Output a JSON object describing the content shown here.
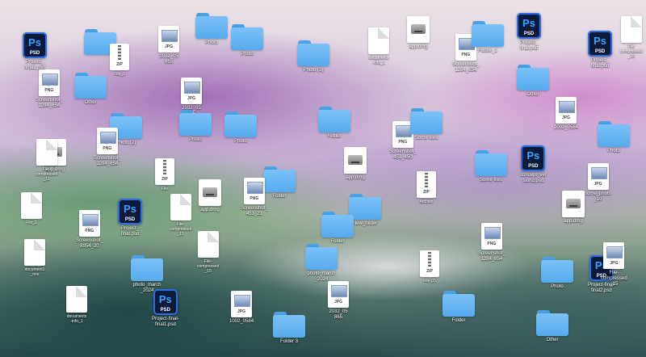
{
  "desktop": {
    "icons": [
      {
        "type": "psd",
        "name": "Project_\nfinal1.psd",
        "badge": "PSD",
        "glyph": "Ps",
        "icon": "photoshop-icon"
      },
      {
        "type": "folder",
        "name": "",
        "icon": "folder-icon"
      },
      {
        "type": "zip",
        "name": "File_1",
        "badge": "ZIP",
        "icon": "zip-file-icon"
      },
      {
        "type": "img",
        "name": "2032_05\n865",
        "badge": "JPG",
        "icon": "image-file-icon"
      },
      {
        "type": "folder",
        "name": "Photo",
        "icon": "folder-icon"
      },
      {
        "type": "folder",
        "name": "Photo",
        "icon": "folder-icon"
      },
      {
        "type": "folder",
        "name": "Photo (3)",
        "icon": "folder-icon"
      },
      {
        "type": "doc",
        "name": "documents\n-info_1",
        "icon": "document-icon"
      },
      {
        "type": "dmg",
        "name": "app.dmg",
        "icon": "disk-image-icon"
      },
      {
        "type": "img",
        "name": "Screenshot_\n1284_654",
        "badge": "PNG",
        "icon": "image-file-icon"
      },
      {
        "type": "folder",
        "name": "Folder_1",
        "icon": "folder-icon"
      },
      {
        "type": "psd",
        "name": "Project_\nfinal.psd",
        "badge": "PSD",
        "glyph": "Ps",
        "icon": "photoshop-icon"
      },
      {
        "type": "psd",
        "name": "Project_\nfinal.psd",
        "badge": "PSD",
        "glyph": "Ps",
        "icon": "photoshop-icon"
      },
      {
        "type": "doc",
        "name": "File\ncompressed\n_16",
        "icon": "document-icon"
      },
      {
        "type": "img",
        "name": "Screenshot_\n1284_654",
        "badge": "PNG",
        "icon": "image-file-icon"
      },
      {
        "type": "folder",
        "name": "Other",
        "icon": "folder-icon"
      },
      {
        "type": "img",
        "name": "2032_05\n865",
        "badge": "JPG",
        "icon": "image-file-icon"
      },
      {
        "type": "folder",
        "name": "Other",
        "icon": "folder-icon"
      },
      {
        "type": "img",
        "name": "1002_0584",
        "badge": "JPG",
        "icon": "image-file-icon"
      },
      {
        "type": "folder",
        "name": "Photo (2)",
        "icon": "folder-icon"
      },
      {
        "type": "folder",
        "name": "Photo",
        "icon": "folder-icon"
      },
      {
        "type": "folder",
        "name": "Photo",
        "icon": "folder-icon"
      },
      {
        "type": "folder",
        "name": "Folder",
        "icon": "folder-icon"
      },
      {
        "type": "img",
        "name": "Screenshot_\n453_450",
        "badge": "PNG",
        "icon": "image-file-icon"
      },
      {
        "type": "folder",
        "name": "Some files",
        "icon": "folder-icon"
      },
      {
        "type": "folder",
        "name": "Photo",
        "icon": "folder-icon"
      },
      {
        "type": "dmg",
        "name": "app.dmg",
        "icon": "disk-image-icon"
      },
      {
        "type": "doc",
        "name": "File-\ncompressed\n_11",
        "icon": "document-icon"
      },
      {
        "type": "img",
        "name": "Screenshot_\n1284_654",
        "badge": "PNG",
        "icon": "image-file-icon"
      },
      {
        "type": "zip",
        "name": "File",
        "badge": "ZIP",
        "icon": "zip-file-icon"
      },
      {
        "type": "folder",
        "name": "Folder",
        "icon": "folder-icon"
      },
      {
        "type": "dmg",
        "name": "app.dmg",
        "icon": "disk-image-icon"
      },
      {
        "type": "zip",
        "name": "Archive",
        "badge": "ZIP",
        "icon": "zip-file-icon"
      },
      {
        "type": "folder",
        "name": "Some files",
        "icon": "folder-icon"
      },
      {
        "type": "psd",
        "name": "concept_ver\nsion2.psd",
        "badge": "PSD",
        "glyph": "Ps",
        "icon": "photoshop-icon"
      },
      {
        "type": "img",
        "name": "some_photo\n_10",
        "badge": "JPG",
        "icon": "image-file-icon"
      },
      {
        "type": "doc",
        "name": "File_1",
        "icon": "document-icon"
      },
      {
        "type": "img",
        "name": "Screenshot_\n453_21",
        "badge": "PNG",
        "icon": "image-file-icon"
      },
      {
        "type": "dmg",
        "name": "app.dmg",
        "icon": "disk-image-icon"
      },
      {
        "type": "doc",
        "name": "File-\ncompressed\n_15",
        "icon": "document-icon"
      },
      {
        "type": "folder",
        "name": "New_folder",
        "icon": "folder-icon"
      },
      {
        "type": "dmg",
        "name": "app.dmg",
        "icon": "disk-image-icon"
      },
      {
        "type": "img",
        "name": "Screenshot_\n8954_20",
        "badge": "PNG",
        "icon": "image-file-icon"
      },
      {
        "type": "psd",
        "name": "Project_\nfinal.psd",
        "badge": "PSD",
        "glyph": "Ps",
        "icon": "photoshop-icon"
      },
      {
        "type": "folder",
        "name": "Folder",
        "icon": "folder-icon"
      },
      {
        "type": "img",
        "name": "Screenshot_\n1284_654",
        "badge": "PNG",
        "icon": "image-file-icon"
      },
      {
        "type": "doc",
        "name": "File-\ncompressed\n_15",
        "icon": "document-icon"
      },
      {
        "type": "doc",
        "name": "document1\n_nov",
        "icon": "document-icon"
      },
      {
        "type": "folder",
        "name": "photo_march\n_2024",
        "icon": "folder-icon"
      },
      {
        "type": "folder",
        "name": "photo_march\n_2024",
        "icon": "folder-icon"
      },
      {
        "type": "zip",
        "name": "File (2)",
        "badge": "ZIP",
        "icon": "zip-file-icon"
      },
      {
        "type": "folder",
        "name": "Photo",
        "icon": "folder-icon"
      },
      {
        "type": "psd",
        "name": "Project-final-\nfinal2.psd",
        "badge": "PSD",
        "glyph": "Ps",
        "icon": "photoshop-icon"
      },
      {
        "type": "img",
        "name": "File-\ncompressed\n_15",
        "badge": "JPG",
        "icon": "image-file-icon"
      },
      {
        "type": "doc",
        "name": "documents\n-info_1",
        "icon": "document-icon"
      },
      {
        "type": "psd",
        "name": "Project-final-\nfinal1.psd",
        "badge": "PSD",
        "glyph": "Ps",
        "icon": "photoshop-icon"
      },
      {
        "type": "img",
        "name": "1002_0584",
        "badge": "JPG",
        "icon": "image-file-icon"
      },
      {
        "type": "img",
        "name": "2032_05\n865",
        "badge": "JPG",
        "icon": "image-file-icon"
      },
      {
        "type": "folder",
        "name": "Folder 3",
        "icon": "folder-icon"
      },
      {
        "type": "folder",
        "name": "Folder",
        "icon": "folder-icon"
      },
      {
        "type": "folder",
        "name": "Other",
        "icon": "folder-icon"
      }
    ]
  }
}
